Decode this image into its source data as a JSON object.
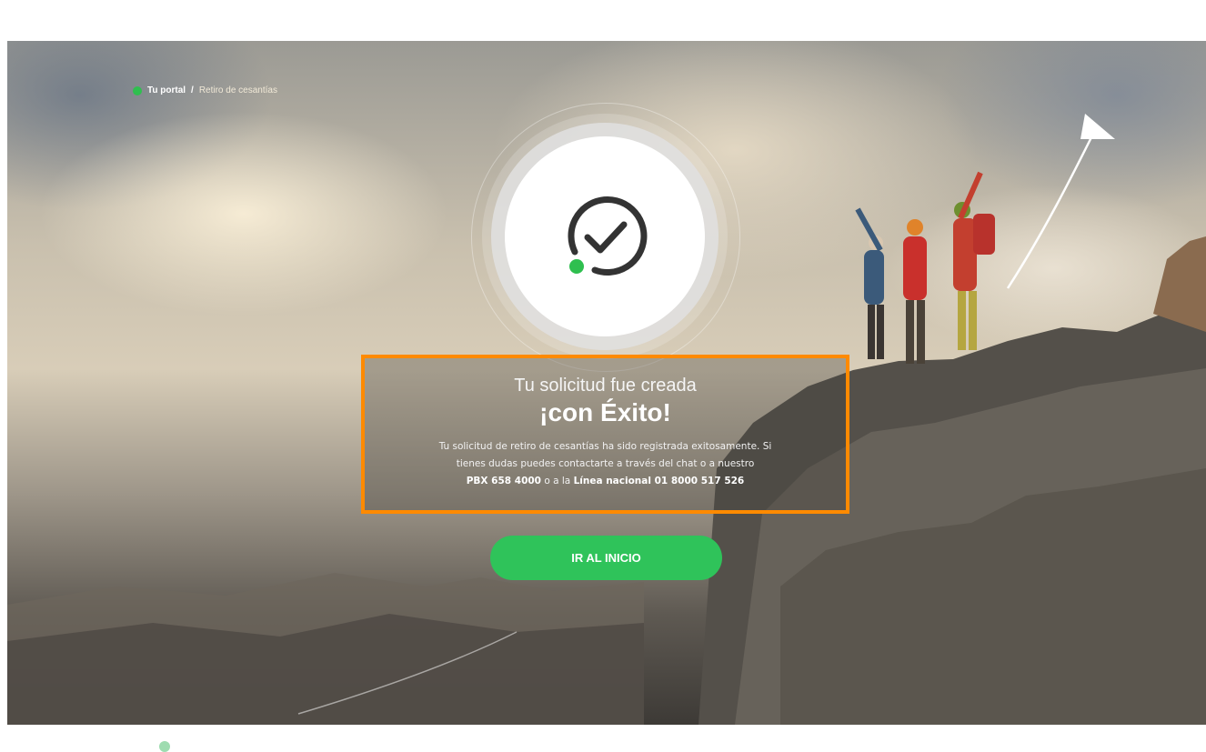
{
  "breadcrumb": {
    "home": "Tu portal",
    "separator": "/",
    "current": "Retiro de cesantías"
  },
  "status": {
    "icon": "check-circle-icon",
    "accent_color": "#2fbf4f"
  },
  "message": {
    "title": "Tu solicitud fue creada",
    "success": "¡con Éxito!",
    "body_line1": "Tu solicitud de retiro de cesantías ha sido registrada exitosamente. Si",
    "body_line2": "tienes dudas puedes contactarte a través del chat o a nuestro",
    "pbx_label": "PBX 658 4000",
    "connector": "o a la",
    "national_line": "Línea nacional 01 8000 517 526",
    "highlight_color": "#ff8a00"
  },
  "cta": {
    "label": "IR AL INICIO",
    "color": "#2fc35a"
  }
}
